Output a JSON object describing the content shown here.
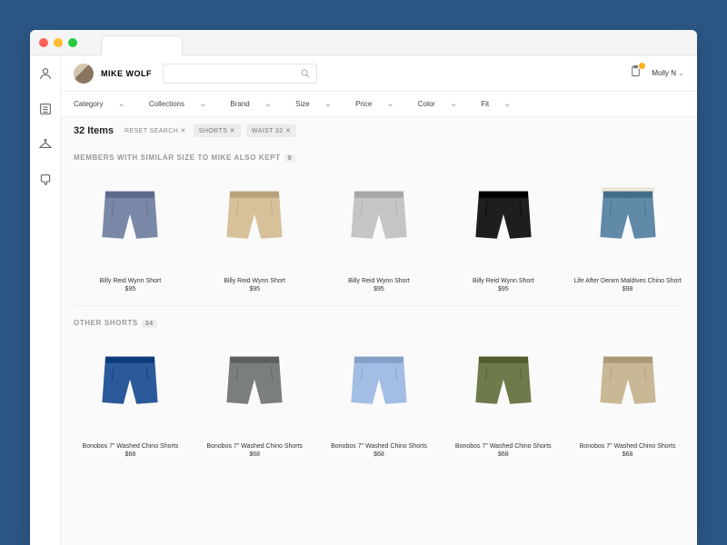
{
  "user": {
    "name": "MIKE WOLF"
  },
  "account": {
    "name": "Molly N"
  },
  "filters": [
    "Category",
    "Collections",
    "Brand",
    "Size",
    "Price",
    "Color",
    "Fit"
  ],
  "results": {
    "count": "32 Items",
    "reset": "RESET SEARCH"
  },
  "chips": [
    "SHORTS",
    "WAIST 32"
  ],
  "section1": {
    "title": "MEMBERS WITH SIMILAR SIZE TO MIKE ALSO KEPT",
    "count": "9"
  },
  "section2": {
    "title": "OTHER SHORTS",
    "count": "34"
  },
  "products1": [
    {
      "name": "Billy Reid Wynn Short",
      "price": "$95",
      "c": "#7a88a8"
    },
    {
      "name": "Billy Reid Wynn Short",
      "price": "$95",
      "c": "#d6c19a"
    },
    {
      "name": "Billy Reid Wynn Short",
      "price": "$95",
      "c": "#c4c6c3"
    },
    {
      "name": "Billy Reid Wynn Short",
      "price": "$95",
      "c": "#1e1e1e"
    },
    {
      "name": "Life After Denim Maldives Chino Short",
      "price": "$98",
      "c": "#6189a8",
      "belt": true
    }
  ],
  "products2": [
    {
      "name": "Bonobos 7\" Washed Chino Shorts",
      "price": "$68",
      "c": "#2a5a9a"
    },
    {
      "name": "Bonobos 7\" Washed Chino Shorts",
      "price": "$68",
      "c": "#7a7e7c"
    },
    {
      "name": "Bonobos 7\" Washed Chino Shorts",
      "price": "$68",
      "c": "#a4bde5"
    },
    {
      "name": "Bonobos 7\" Washed Chino Shorts",
      "price": "$68",
      "c": "#6e7a4a"
    },
    {
      "name": "Bonobos 7\" Washed Chino Shorts",
      "price": "$68",
      "c": "#c8b896"
    }
  ]
}
